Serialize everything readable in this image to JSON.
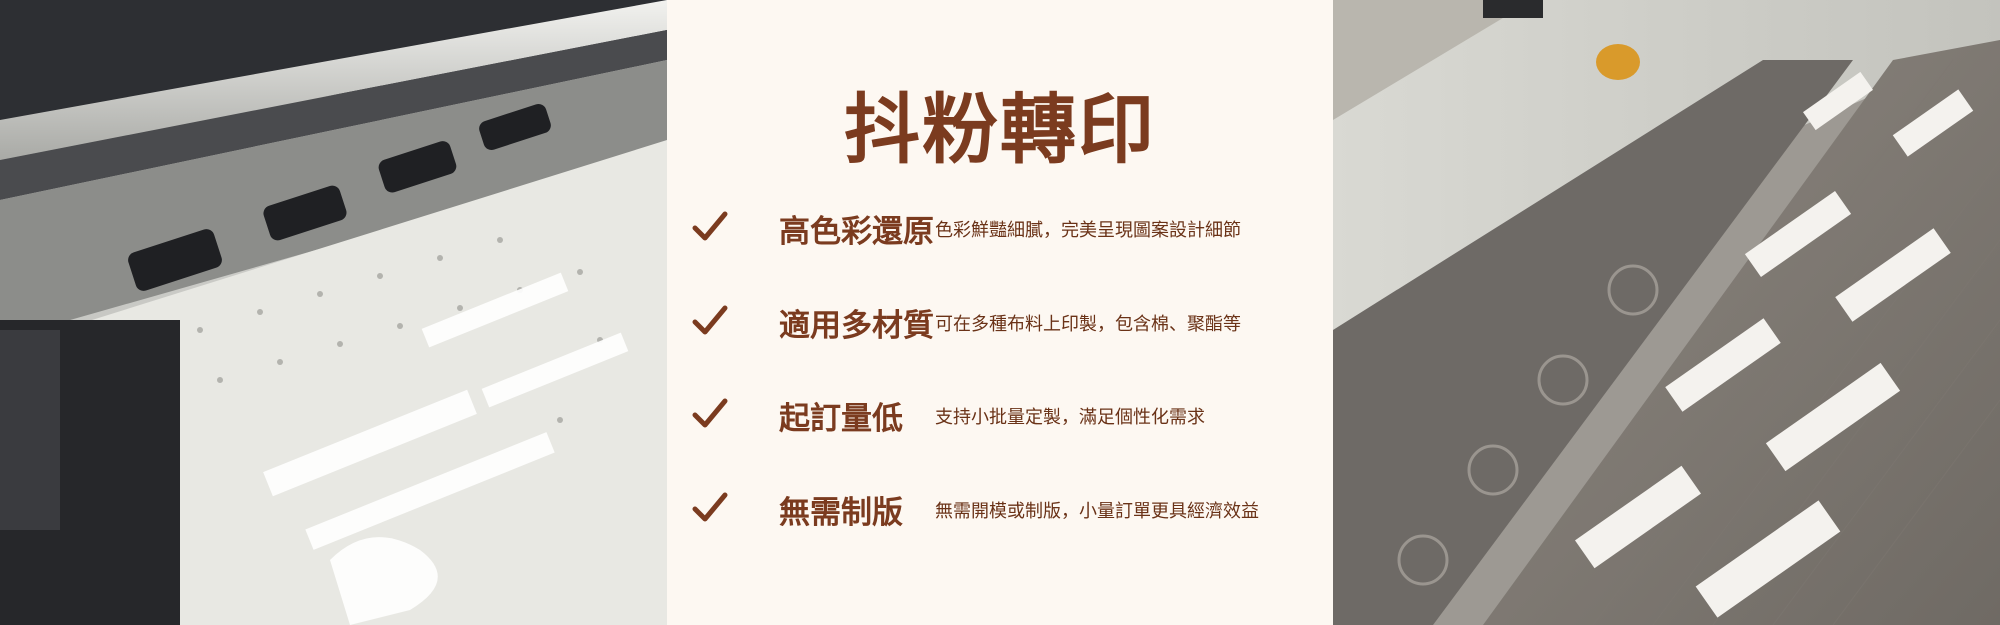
{
  "title": "抖粉轉印",
  "features": [
    {
      "title": "高色彩還原",
      "desc": "色彩鮮豔細膩，完美呈現圖案設計細節"
    },
    {
      "title": "適用多材質",
      "desc": "可在多種布料上印製，包含棉、聚酯等"
    },
    {
      "title": "起訂量低",
      "desc": "支持小批量定製，滿足個性化需求"
    },
    {
      "title": "無需制版",
      "desc": "無需開模或制版，小量訂單更具經濟效益"
    }
  ],
  "colors": {
    "accent": "#7b3b1f",
    "panel_background": "#fdf8f2"
  },
  "icons": {
    "feature_bullet": "checkmark-icon"
  }
}
